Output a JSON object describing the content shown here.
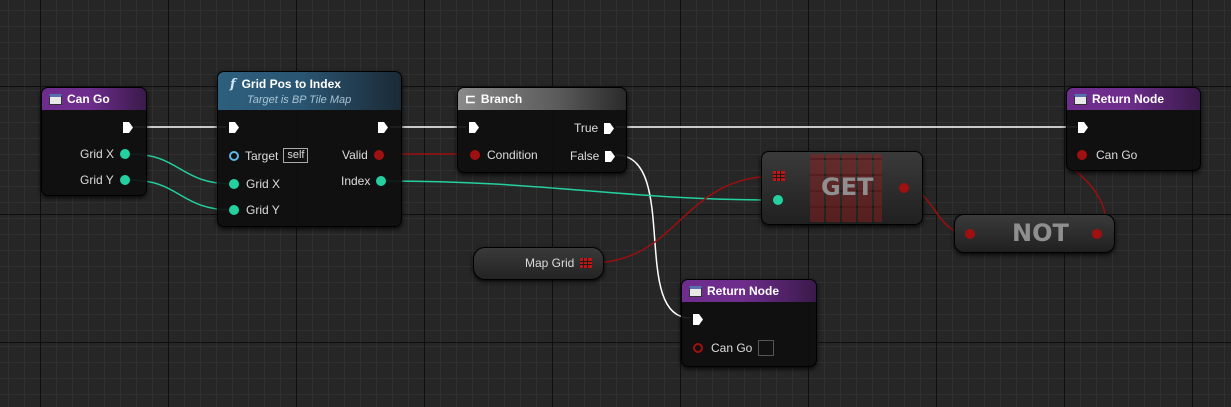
{
  "nodes": {
    "can_go": {
      "title": "Can Go",
      "pins": [
        "Grid X",
        "Grid Y"
      ]
    },
    "grid_pos_to_index": {
      "title": "Grid Pos to Index",
      "subtitle": "Target is BP Tile Map",
      "inputs": [
        "Target",
        "Grid X",
        "Grid Y"
      ],
      "self_label": "self",
      "outputs": [
        "Valid",
        "Index"
      ]
    },
    "branch": {
      "title": "Branch",
      "input": "Condition",
      "outputs": [
        "True",
        "False"
      ]
    },
    "map_grid": {
      "label": "Map Grid"
    },
    "get": {
      "label": "GET"
    },
    "not": {
      "label": "NOT"
    },
    "return_top": {
      "title": "Return Node",
      "pin": "Can Go"
    },
    "return_bottom": {
      "title": "Return Node",
      "pin": "Can Go"
    }
  },
  "icons": {
    "event": "event-icon",
    "function": "function-icon",
    "branch": "branch-icon",
    "array": "array-grid-icon"
  },
  "colors": {
    "purple_header": "#6e2d8d",
    "function_header": "#2d607e",
    "branch_header": "#8a8a8a",
    "integer_pin": "#24d0a0",
    "boolean_pin": "#a01010",
    "object_pin": "#5fb5e6",
    "exec_wire": "#ffffff"
  }
}
